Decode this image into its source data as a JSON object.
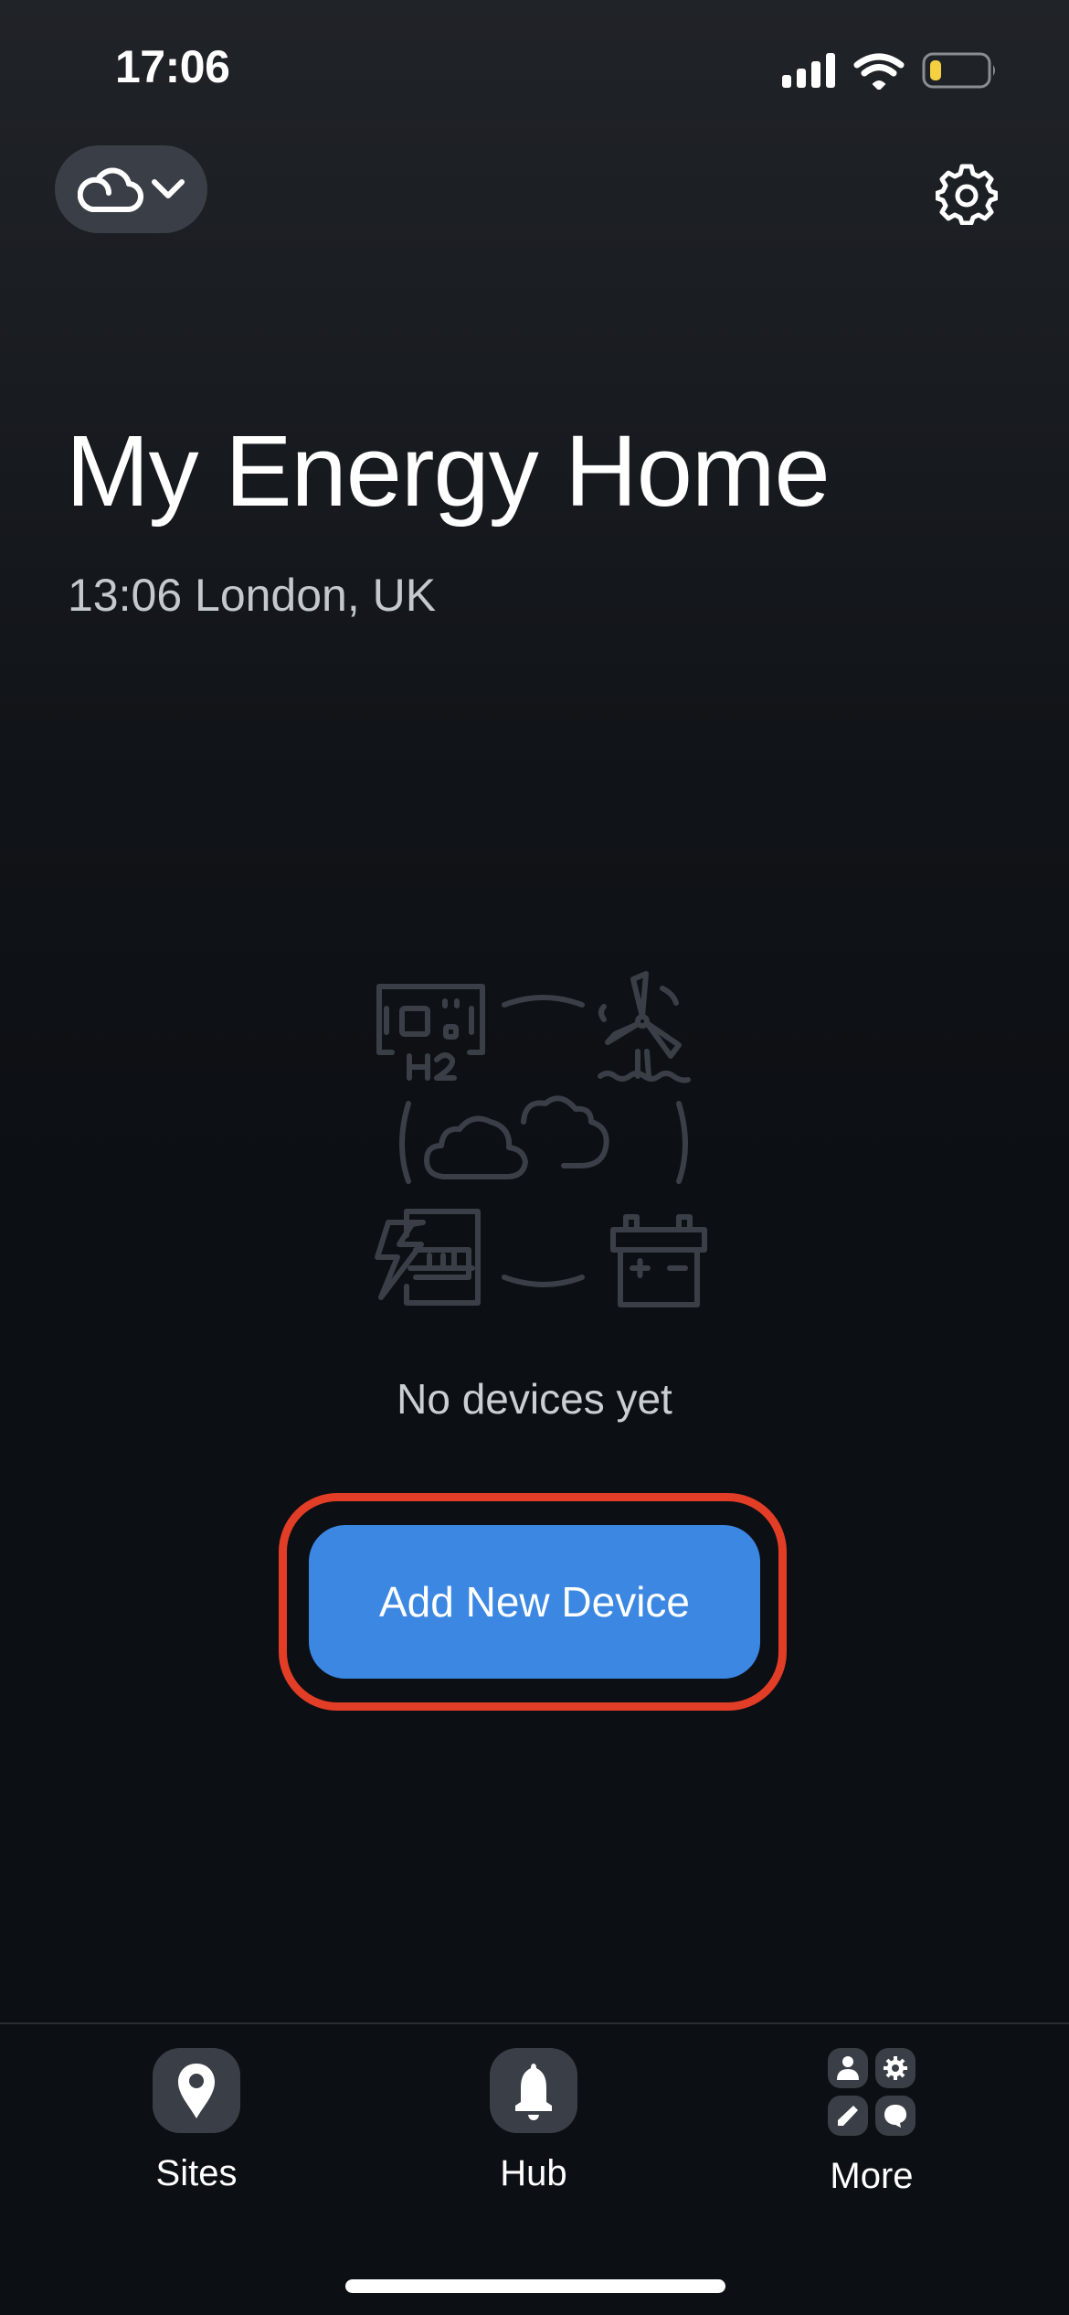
{
  "status_bar": {
    "time": "17:06",
    "icons": [
      "cellular-signal-icon",
      "wifi-icon",
      "battery-low-icon"
    ],
    "battery_color": "#f5d142"
  },
  "header": {
    "mode_selector_icon": "cloud-icon",
    "mode_selector_chevron": "chevron-down-icon",
    "settings_icon": "gear-icon"
  },
  "site": {
    "title": "My Energy Home",
    "subtitle": "13:06 London, UK"
  },
  "empty_state": {
    "illustration_icons": [
      "hydrogen-h2-icon",
      "wind-turbine-icon",
      "cloud-icon",
      "energy-meter-icon",
      "battery-icon"
    ],
    "message": "No devices yet",
    "button_label": "Add New Device",
    "button_color": "#3b87e2",
    "highlight_color": "#e23d26"
  },
  "tab_bar": {
    "tabs": [
      {
        "label": "Sites",
        "icon": "map-pin-icon"
      },
      {
        "label": "Hub",
        "icon": "bell-icon"
      },
      {
        "label": "More",
        "icon": "more-grid-icon"
      }
    ]
  }
}
